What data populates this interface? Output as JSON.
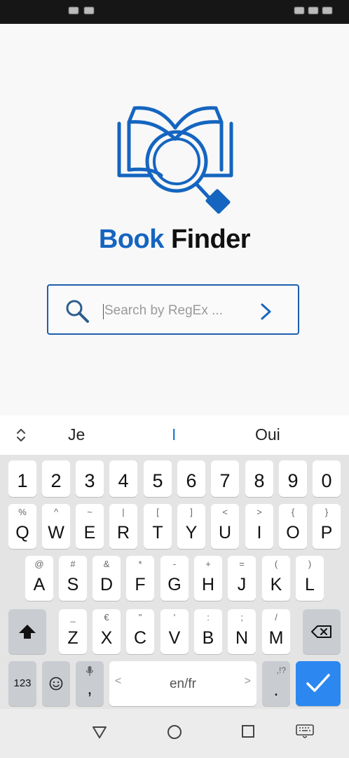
{
  "app": {
    "title_part1": "Book",
    "title_part2": "Finder",
    "search": {
      "placeholder": "Search by RegEx ..."
    },
    "colors": {
      "accent": "#1565c0",
      "border": "#1c5fae"
    }
  },
  "keyboard": {
    "suggestions": [
      "Je",
      "I",
      "Oui"
    ],
    "number_row": [
      "1",
      "2",
      "3",
      "4",
      "5",
      "6",
      "7",
      "8",
      "9",
      "0"
    ],
    "row1": [
      {
        "main": "Q",
        "hint": "%"
      },
      {
        "main": "W",
        "hint": "^"
      },
      {
        "main": "E",
        "hint": "~"
      },
      {
        "main": "R",
        "hint": "|"
      },
      {
        "main": "T",
        "hint": "["
      },
      {
        "main": "Y",
        "hint": "]"
      },
      {
        "main": "U",
        "hint": "<"
      },
      {
        "main": "I",
        "hint": ">"
      },
      {
        "main": "O",
        "hint": "{"
      },
      {
        "main": "P",
        "hint": "}"
      }
    ],
    "row2": [
      {
        "main": "A",
        "hint": "@"
      },
      {
        "main": "S",
        "hint": "#"
      },
      {
        "main": "D",
        "hint": "&"
      },
      {
        "main": "F",
        "hint": "*"
      },
      {
        "main": "G",
        "hint": "-"
      },
      {
        "main": "H",
        "hint": "+"
      },
      {
        "main": "J",
        "hint": "="
      },
      {
        "main": "K",
        "hint": "("
      },
      {
        "main": "L",
        "hint": ")"
      }
    ],
    "row3": [
      {
        "main": "Z",
        "hint": "_"
      },
      {
        "main": "X",
        "hint": "€"
      },
      {
        "main": "C",
        "hint": "\""
      },
      {
        "main": "V",
        "hint": "'"
      },
      {
        "main": "B",
        "hint": ":"
      },
      {
        "main": "N",
        "hint": ";"
      },
      {
        "main": "M",
        "hint": "/"
      }
    ],
    "bottom": {
      "symbols_label": "123",
      "comma": ",",
      "space_label": "en/fr",
      "space_left": "<",
      "space_right": ">",
      "period": ".",
      "period_hint": ",!?"
    }
  }
}
